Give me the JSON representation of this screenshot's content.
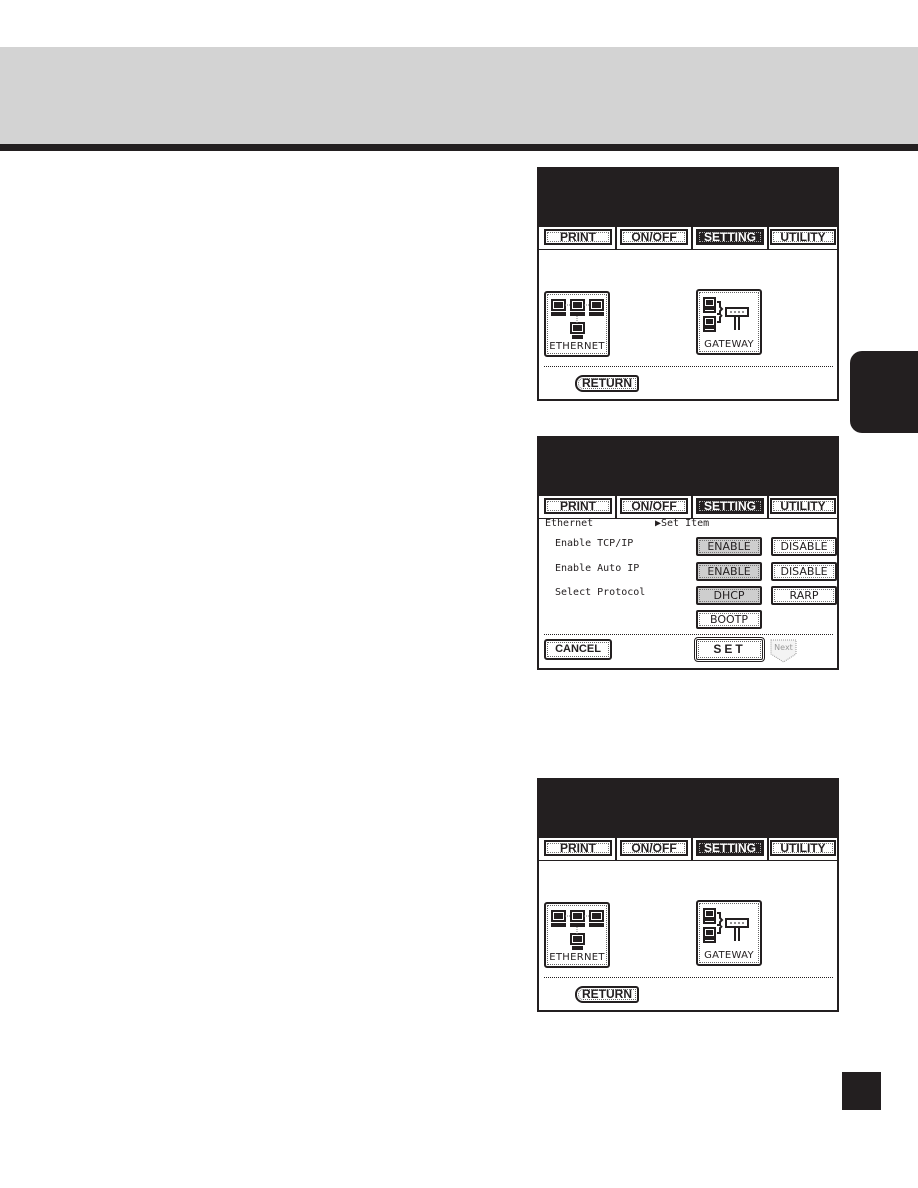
{
  "page": {
    "page_number": ""
  },
  "tabs": [
    {
      "label": "PRINT",
      "active": false
    },
    {
      "label": "ON/OFF",
      "active": false
    },
    {
      "label": "SETTING",
      "active": true
    },
    {
      "label": "UTILITY",
      "active": false
    }
  ],
  "network_menu": {
    "ethernet_label": "ETHERNET",
    "gateway_label": "GATEWAY",
    "return_label": "RETURN"
  },
  "ethernet_settings": {
    "section_title": "Ethernet",
    "instruction": "▶Set Item",
    "rows": [
      {
        "label": "Enable TCP/IP",
        "options": [
          {
            "label": "ENABLE",
            "selected": true
          },
          {
            "label": "DISABLE",
            "selected": false
          }
        ]
      },
      {
        "label": "Enable Auto IP",
        "options": [
          {
            "label": "ENABLE",
            "selected": true
          },
          {
            "label": "DISABLE",
            "selected": false
          }
        ]
      },
      {
        "label": "Select Protocol",
        "options": [
          {
            "label": "DHCP",
            "selected": true
          },
          {
            "label": "RARP",
            "selected": false
          },
          {
            "label": "BOOTP",
            "selected": false
          }
        ]
      }
    ],
    "cancel_label": "CANCEL",
    "set_label": "SET",
    "next_label": "Next"
  }
}
